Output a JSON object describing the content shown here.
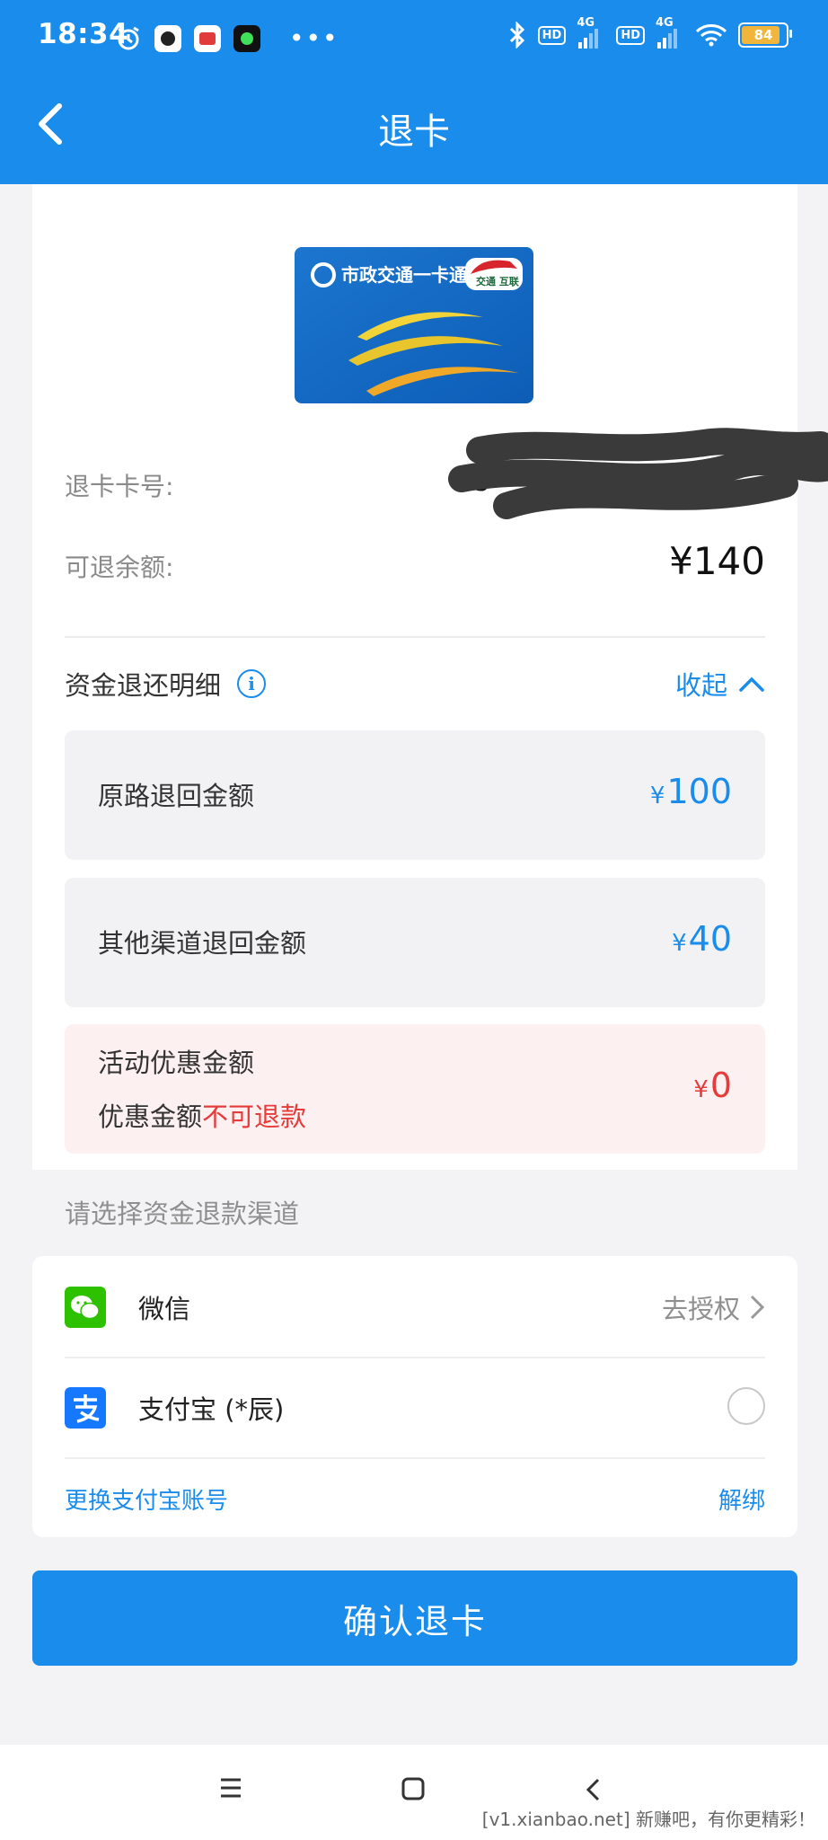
{
  "status_bar": {
    "time": "18:34",
    "more": "•••",
    "hd1": "HD",
    "net1": "4G",
    "hd2": "HD",
    "net2": "4G",
    "battery": "84"
  },
  "header": {
    "title": "退卡"
  },
  "card_image": {
    "brand": "市政交通一卡通",
    "badge": "交通 互联"
  },
  "info": {
    "card_number_label": "退卡卡号:",
    "card_number_value": "5",
    "balance_label": "可退余额:",
    "balance_value": "¥140"
  },
  "refund_details": {
    "title": "资金退还明细",
    "toggle_label": "收起",
    "items": [
      {
        "label": "原路退回金额",
        "currency": "¥",
        "amount": "100"
      },
      {
        "label": "其他渠道退回金额",
        "currency": "¥",
        "amount": "40"
      },
      {
        "label": "活动优惠金额",
        "sublabel_prefix": "优惠金额",
        "sublabel_warning": "不可退款",
        "currency": "¥",
        "amount": "0"
      }
    ]
  },
  "channel": {
    "hint": "请选择资金退款渠道",
    "options": [
      {
        "name": "微信",
        "action": "去授权"
      },
      {
        "name": "支付宝 (*辰)"
      }
    ],
    "change_account": "更换支付宝账号",
    "unbind": "解绑"
  },
  "confirm_button": "确认退卡",
  "watermark": "[v1.xianbao.net] 新赚吧，有你更精彩！",
  "colors": {
    "primary": "#1a8cec",
    "warning": "#e63b3b",
    "wechat": "#2dc100",
    "alipay": "#1677ff"
  }
}
